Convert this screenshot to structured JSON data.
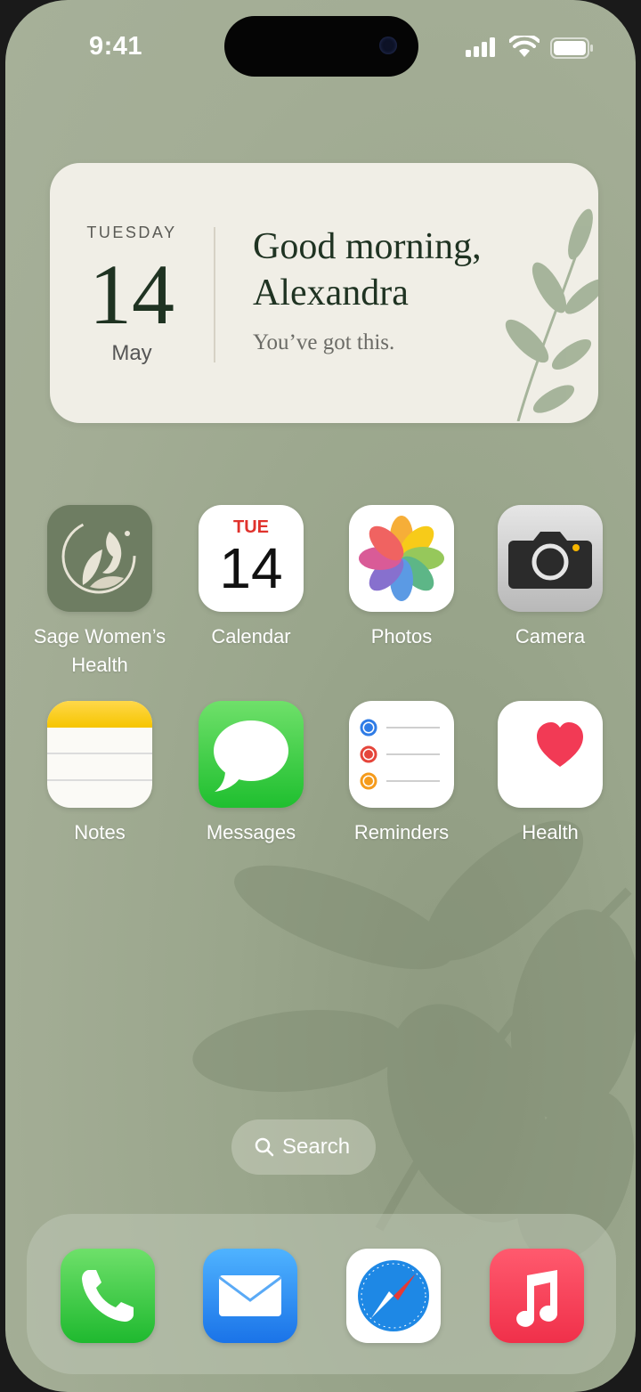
{
  "status_bar": {
    "time": "9:41"
  },
  "widget": {
    "weekday": "TUESDAY",
    "day": "14",
    "month": "May",
    "greeting_line1": "Good morning,",
    "greeting_line2": "Alexandra",
    "subtitle": "You’ve got this."
  },
  "apps": [
    {
      "label_line1": "Sage Women’s",
      "label_line2": "Health",
      "icon": "sage-logo-icon"
    },
    {
      "label": "Calendar",
      "icon": "calendar-icon",
      "icon_day": "TUE",
      "icon_date": "14"
    },
    {
      "label": "Photos",
      "icon": "photos-icon"
    },
    {
      "label": "Camera",
      "icon": "camera-icon"
    },
    {
      "label": "Notes",
      "icon": "notes-icon"
    },
    {
      "label": "Messages",
      "icon": "messages-icon"
    },
    {
      "label": "Reminders",
      "icon": "reminders-icon"
    },
    {
      "label": "Health",
      "icon": "heart-icon"
    }
  ],
  "search": {
    "label": "Search"
  },
  "dock": [
    {
      "icon": "phone-icon"
    },
    {
      "icon": "mail-icon"
    },
    {
      "icon": "safari-icon"
    },
    {
      "icon": "music-icon"
    }
  ],
  "colors": {
    "wallpaper": "#a3ad95",
    "widget_bg": "#f0eee6",
    "greeting_text": "#1f3322",
    "calendar_red": "#e0322c"
  }
}
